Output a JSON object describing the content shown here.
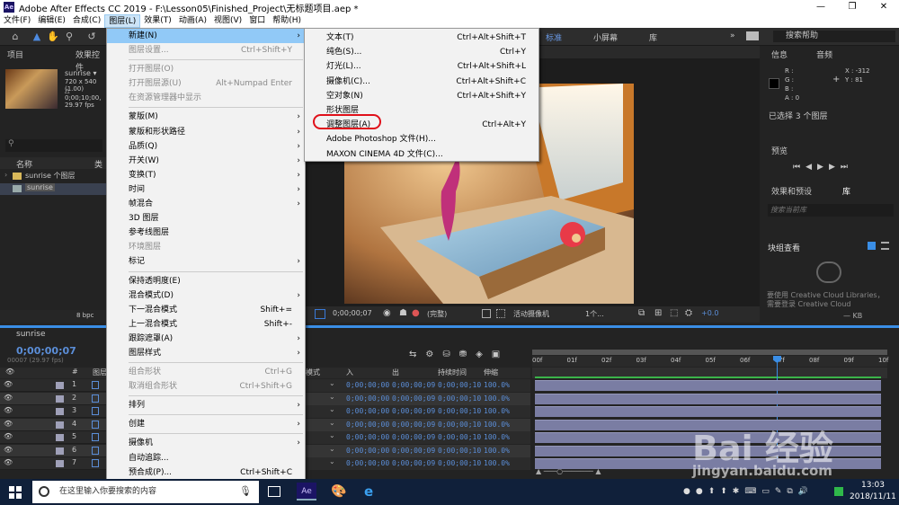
{
  "window": {
    "title": "Adobe After Effects CC 2019 - F:\\Lesson05\\Finished_Project\\无标题项目.aep *",
    "minimize": "—",
    "restore": "❐",
    "close": "✕"
  },
  "menubar": [
    "文件(F)",
    "编辑(E)",
    "合成(C)",
    "图层(L)",
    "效果(T)",
    "动画(A)",
    "视图(V)",
    "窗口",
    "帮助(H)"
  ],
  "workspace": {
    "standard": "标准",
    "small_screen": "小屏幕",
    "library": "库",
    "search_help": "搜索帮助"
  },
  "project": {
    "tab": "项目",
    "effects_tab": "效果控件",
    "comp_name": "sunrise ▾",
    "comp_info1": "720 x 540 (1.00)",
    "comp_info2": "△ 0;00;10;00, 29.97 fps",
    "col_name": "名称",
    "col_type": "类",
    "items": [
      {
        "name": "sunrise 个图层",
        "color": "#e0c23a"
      },
      {
        "name": "sunrise",
        "color": "#c8c8c8"
      }
    ],
    "bpc": "8 bpc"
  },
  "layer_menu": {
    "items": [
      {
        "label": "新建(N)",
        "sc": "",
        "arrow": "›",
        "state": "hl"
      },
      {
        "label": "图层设置...",
        "sc": "Ctrl+Shift+Y",
        "arrow": "",
        "state": "dis"
      },
      {
        "sep": true
      },
      {
        "label": "打开图层(O)",
        "sc": "",
        "arrow": "",
        "state": "dis"
      },
      {
        "label": "打开图层源(U)",
        "sc": "Alt+Numpad Enter",
        "arrow": "",
        "state": "dis"
      },
      {
        "label": "在资源管理器中显示",
        "sc": "",
        "arrow": "",
        "state": "dis"
      },
      {
        "sep": true
      },
      {
        "label": "蒙版(M)",
        "sc": "",
        "arrow": "›",
        "state": ""
      },
      {
        "label": "蒙版和形状路径",
        "sc": "",
        "arrow": "›",
        "state": ""
      },
      {
        "label": "品质(Q)",
        "sc": "",
        "arrow": "›",
        "state": ""
      },
      {
        "label": "开关(W)",
        "sc": "",
        "arrow": "›",
        "state": ""
      },
      {
        "label": "变换(T)",
        "sc": "",
        "arrow": "›",
        "state": ""
      },
      {
        "label": "时间",
        "sc": "",
        "arrow": "›",
        "state": ""
      },
      {
        "label": "帧混合",
        "sc": "",
        "arrow": "›",
        "state": ""
      },
      {
        "label": "3D 图层",
        "sc": "",
        "arrow": "",
        "state": ""
      },
      {
        "label": "参考线图层",
        "sc": "",
        "arrow": "",
        "state": ""
      },
      {
        "label": "环境图层",
        "sc": "",
        "arrow": "",
        "state": "dis"
      },
      {
        "label": "标记",
        "sc": "",
        "arrow": "›",
        "state": ""
      },
      {
        "sep": true
      },
      {
        "label": "保持透明度(E)",
        "sc": "",
        "arrow": "",
        "state": ""
      },
      {
        "label": "混合模式(D)",
        "sc": "",
        "arrow": "›",
        "state": ""
      },
      {
        "label": "下一混合模式",
        "sc": "Shift+=",
        "arrow": "",
        "state": ""
      },
      {
        "label": "上一混合模式",
        "sc": "Shift+-",
        "arrow": "",
        "state": ""
      },
      {
        "label": "跟踪遮罩(A)",
        "sc": "",
        "arrow": "›",
        "state": ""
      },
      {
        "label": "图层样式",
        "sc": "",
        "arrow": "›",
        "state": ""
      },
      {
        "sep": true
      },
      {
        "label": "组合形状",
        "sc": "Ctrl+G",
        "arrow": "",
        "state": "dis"
      },
      {
        "label": "取消组合形状",
        "sc": "Ctrl+Shift+G",
        "arrow": "",
        "state": "dis"
      },
      {
        "sep": true
      },
      {
        "label": "排列",
        "sc": "",
        "arrow": "›",
        "state": ""
      },
      {
        "sep": true
      },
      {
        "label": "创建",
        "sc": "",
        "arrow": "›",
        "state": ""
      },
      {
        "sep": true
      },
      {
        "label": "摄像机",
        "sc": "",
        "arrow": "›",
        "state": ""
      },
      {
        "label": "自动追踪...",
        "sc": "",
        "arrow": "",
        "state": ""
      },
      {
        "label": "预合成(P)...",
        "sc": "Ctrl+Shift+C",
        "arrow": "",
        "state": ""
      }
    ]
  },
  "new_submenu": {
    "items": [
      {
        "label": "文本(T)",
        "sc": "Ctrl+Alt+Shift+T"
      },
      {
        "label": "纯色(S)...",
        "sc": "Ctrl+Y"
      },
      {
        "label": "灯光(L)...",
        "sc": "Ctrl+Alt+Shift+L"
      },
      {
        "label": "摄像机(C)...",
        "sc": "Ctrl+Alt+Shift+C"
      },
      {
        "label": "空对象(N)",
        "sc": "Ctrl+Alt+Shift+Y"
      },
      {
        "label": "形状图层",
        "sc": ""
      },
      {
        "label": "调整图层(A)",
        "sc": "Ctrl+Alt+Y"
      },
      {
        "label": "Adobe Photoshop 文件(H)...",
        "sc": ""
      },
      {
        "label": "MAXON CINEMA 4D 文件(C)...",
        "sc": ""
      }
    ]
  },
  "viewer": {
    "timecode": "0;00;00;07",
    "mode": "(完整)",
    "camera": "活动摄像机",
    "views": "1个...",
    "exposure": "+0.0"
  },
  "info": {
    "tab": "信息",
    "audio_tab": "音频",
    "r": "R :",
    "g": "G :",
    "b": "B :",
    "a": "A : 0",
    "x": "X : -312",
    "y": "Y : 81",
    "selected": "已选择 3 个图层"
  },
  "preview": {
    "tab": "预览"
  },
  "effects": {
    "tab": "效果和预设",
    "lib_tab": "库",
    "search": "搜索当前库",
    "browse": "块组查看",
    "cc_msg1": "要使用 Creative Cloud Libraries，",
    "cc_msg2": "需要登录 Creative Cloud",
    "kb": "— KB"
  },
  "timeline": {
    "comp_tab": "sunrise",
    "timecode": "0;00;00;07",
    "fps": "00007 (29.97 fps)",
    "hdr_layer": "图层",
    "hdr_num": "#",
    "col_mode": "模式",
    "col_in": "入",
    "col_out": "出",
    "col_dur": "持续时间",
    "col_stretch": "伸缩",
    "ruler": [
      "00f",
      "01f",
      "02f",
      "03f",
      "04f",
      "05f",
      "06f",
      "07f",
      "08f",
      "09f",
      "10f"
    ],
    "rows": [
      {
        "n": "1",
        "in": "0;00;00;00",
        "out": "0;00;00;09",
        "dur": "0;00;00;10",
        "st": "100.0%"
      },
      {
        "n": "2",
        "in": "0;00;00;00",
        "out": "0;00;00;09",
        "dur": "0;00;00;10",
        "st": "100.0%"
      },
      {
        "n": "3",
        "in": "0;00;00;00",
        "out": "0;00;00;09",
        "dur": "0;00;00;10",
        "st": "100.0%"
      },
      {
        "n": "4",
        "in": "0;00;00;00",
        "out": "0;00;00;09",
        "dur": "0;00;00;10",
        "st": "100.0%"
      },
      {
        "n": "5",
        "in": "0;00;00;00",
        "out": "0;00;00;09",
        "dur": "0;00;00;10",
        "st": "100.0%"
      },
      {
        "n": "6",
        "in": "0;00;00;00",
        "out": "0;00;00;09",
        "dur": "0;00;00;10",
        "st": "100.0%"
      },
      {
        "n": "7",
        "in": "0;00;00;00",
        "out": "0;00;00;09",
        "dur": "0;00;00;10",
        "st": "100.0%"
      }
    ]
  },
  "watermark": {
    "brand": "Bai 经验",
    "url": "jingyan.baidu.com"
  },
  "taskbar": {
    "search": "在这里输入你要搜索的内容",
    "time": "13:03",
    "date": "2018/11/11",
    "ae": "Ae"
  }
}
